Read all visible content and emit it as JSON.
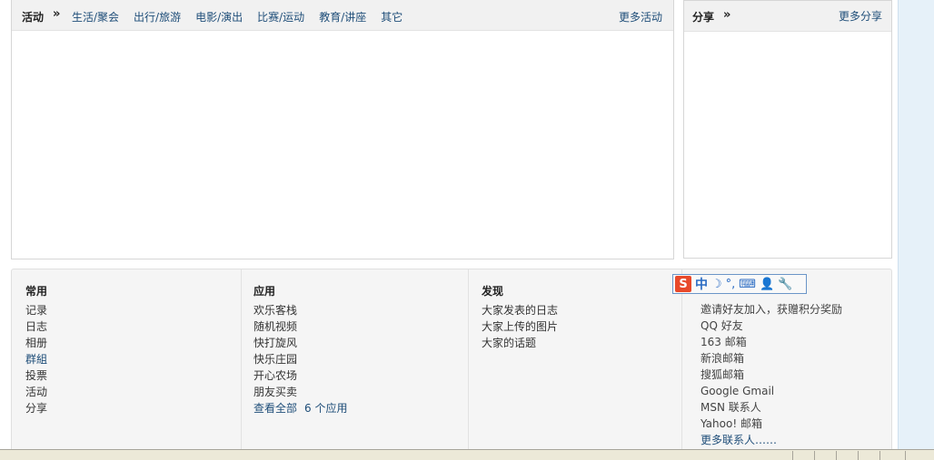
{
  "activity": {
    "title": "活动",
    "raquo": "»",
    "tabs": [
      "生活/聚会",
      "出行/旅游",
      "电影/演出",
      "比赛/运动",
      "教育/讲座",
      "其它"
    ],
    "more": "更多活动"
  },
  "share": {
    "title": "分享",
    "raquo": "»",
    "more": "更多分享"
  },
  "footer": {
    "common": {
      "title": "常用",
      "items": [
        "记录",
        "日志",
        "相册",
        "群組",
        "投票",
        "活动",
        "分享"
      ]
    },
    "apps": {
      "title": "应用",
      "items": [
        "欢乐客栈",
        "随机视频",
        "快打旋风",
        "快乐庄园",
        "开心农场",
        "朋友买卖"
      ],
      "view_all": "查看全部",
      "app_count": "6 个应用"
    },
    "discover": {
      "title": "发现",
      "items": [
        "大家发表的日志",
        "大家上传的图片",
        "大家的话题"
      ]
    },
    "invite": {
      "items": [
        "邀请好友加入，获赠积分奖励",
        "QQ 好友",
        "163 邮箱",
        "新浪邮箱",
        "搜狐邮箱",
        "Google Gmail",
        "MSN 联系人",
        "Yahoo! 邮箱"
      ],
      "more": "更多联系人……"
    }
  },
  "ime": {
    "logo": "S",
    "mode": "中",
    "moon": "☽",
    "punct": "°,",
    "keyboard": "⌨",
    "user": "👤",
    "wrench": "🔧"
  }
}
